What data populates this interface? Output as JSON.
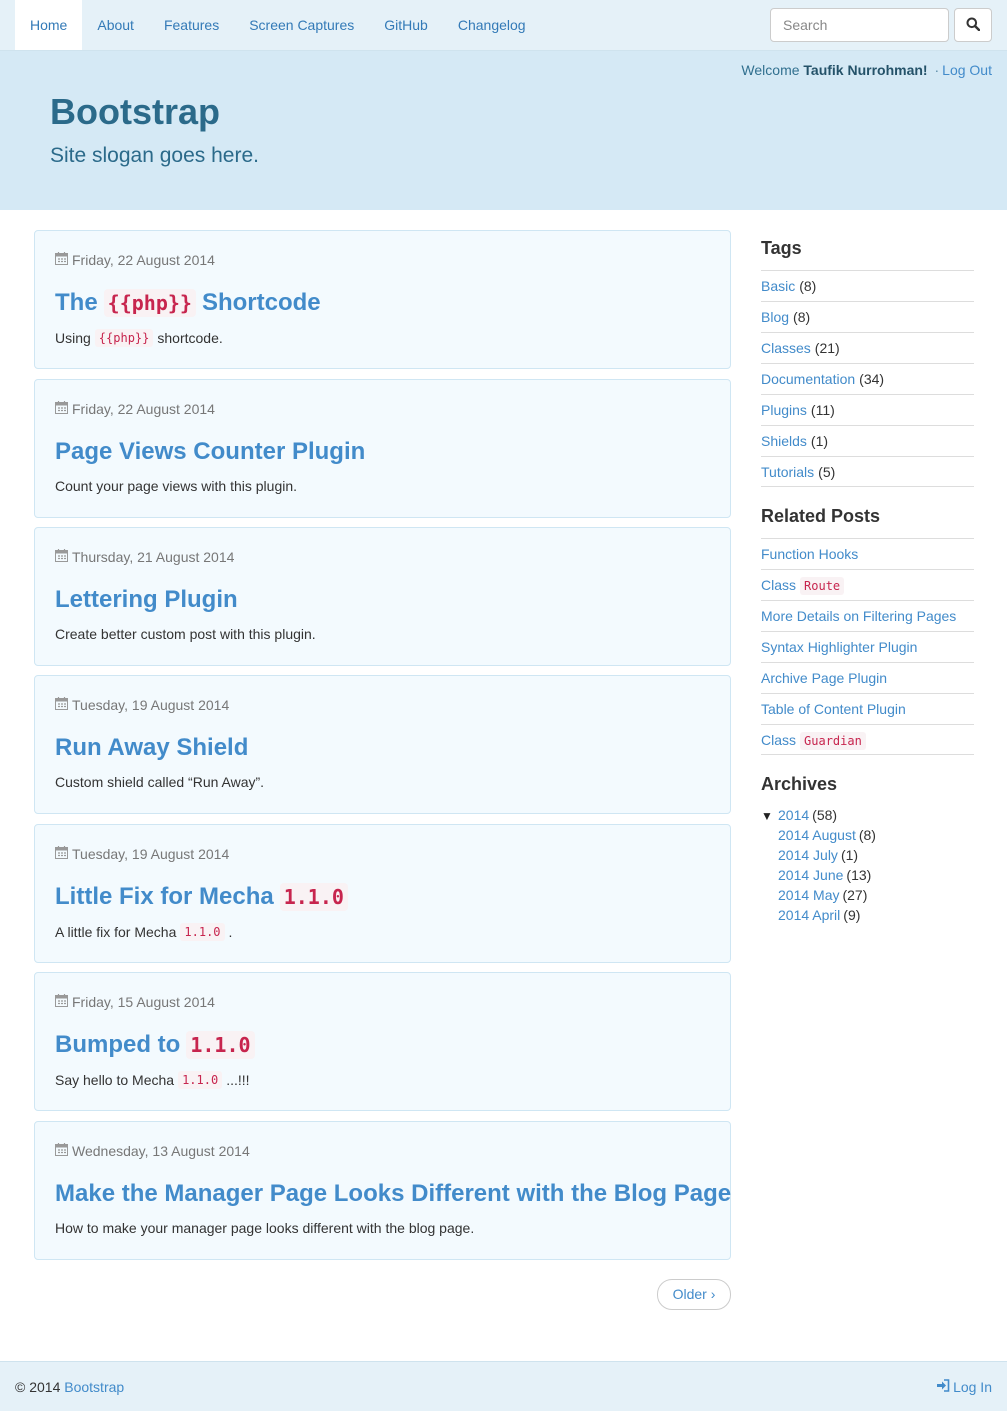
{
  "nav": {
    "items": [
      "Home",
      "About",
      "Features",
      "Screen Captures",
      "GitHub",
      "Changelog"
    ],
    "search_placeholder": "Search"
  },
  "header": {
    "welcome_prefix": "Welcome",
    "user_name": "Taufik Nurrohman!",
    "separator": "·",
    "logout": "Log Out",
    "title": "Bootstrap",
    "slogan": "Site slogan goes here."
  },
  "posts": [
    {
      "date": "Friday, 22 August 2014",
      "title_pre": "The",
      "title_code": "{{php}}",
      "title_post": "Shortcode",
      "excerpt_pre": "Using",
      "excerpt_code": "{{php}}",
      "excerpt_post": "shortcode."
    },
    {
      "date": "Friday, 22 August 2014",
      "title_pre": "Page Views Counter Plugin",
      "excerpt_pre": "Count your page views with this plugin."
    },
    {
      "date": "Thursday, 21 August 2014",
      "title_pre": "Lettering Plugin",
      "excerpt_pre": "Create better custom post with this plugin."
    },
    {
      "date": "Tuesday, 19 August 2014",
      "title_pre": "Run Away Shield",
      "excerpt_pre": "Custom shield called “Run Away”."
    },
    {
      "date": "Tuesday, 19 August 2014",
      "title_pre": "Little Fix for Mecha",
      "title_code": "1.1.0",
      "excerpt_pre": "A little fix for Mecha",
      "excerpt_code": "1.1.0",
      "excerpt_post": "."
    },
    {
      "date": "Friday, 15 August 2014",
      "title_pre": "Bumped to",
      "title_code": "1.1.0",
      "excerpt_pre": "Say hello to Mecha",
      "excerpt_code": "1.1.0",
      "excerpt_post": "...!!!"
    },
    {
      "date": "Wednesday, 13 August 2014",
      "title_pre": "Make the Manager Page Looks Different with the Blog Page",
      "excerpt_pre": "How to make your manager page looks different with the blog page."
    }
  ],
  "pagination": {
    "older": "Older ›"
  },
  "sidebar": {
    "tags_heading": "Tags",
    "tags": [
      {
        "name": "Basic",
        "count": "(8)"
      },
      {
        "name": "Blog",
        "count": "(8)"
      },
      {
        "name": "Classes",
        "count": "(21)"
      },
      {
        "name": "Documentation",
        "count": "(34)"
      },
      {
        "name": "Plugins",
        "count": "(11)"
      },
      {
        "name": "Shields",
        "count": "(1)"
      },
      {
        "name": "Tutorials",
        "count": "(5)"
      }
    ],
    "related_heading": "Related Posts",
    "related": [
      {
        "text": "Function Hooks"
      },
      {
        "text": "Class",
        "code": "Route"
      },
      {
        "text": "More Details on Filtering Pages"
      },
      {
        "text": "Syntax Highlighter Plugin"
      },
      {
        "text": "Archive Page Plugin"
      },
      {
        "text": "Table of Content Plugin"
      },
      {
        "text": "Class",
        "code": "Guardian"
      }
    ],
    "archives_heading": "Archives",
    "archive_year": {
      "toggle": "▼",
      "label": "2014",
      "count": "(58)"
    },
    "archive_months": [
      {
        "label": "2014 August",
        "count": "(8)"
      },
      {
        "label": "2014 July",
        "count": "(1)"
      },
      {
        "label": "2014 June",
        "count": "(13)"
      },
      {
        "label": "2014 May",
        "count": "(27)"
      },
      {
        "label": "2014 April",
        "count": "(9)"
      }
    ]
  },
  "footer": {
    "copyright": "© 2014",
    "site_link": "Bootstrap",
    "login": "Log In"
  }
}
